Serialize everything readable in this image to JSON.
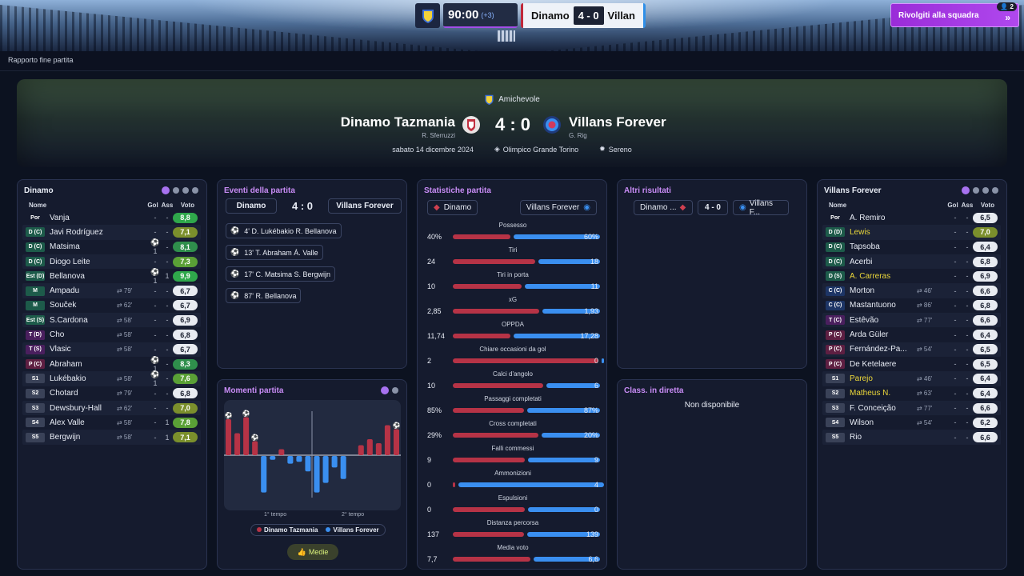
{
  "topbar": {
    "time": "90:00",
    "added_time": "(+3)",
    "home_short": "Dinamo",
    "score": "4 - 0",
    "away_short": "Villan",
    "cta_label": "Rivolgiti alla squadra",
    "cta_badge": "2"
  },
  "breadcrumb": "Rapporto fine partita",
  "match": {
    "competition": "Amichevole",
    "home": "Dinamo Tazmania",
    "home_coach": "R. Sferruzzi",
    "away": "Villans Forever",
    "away_coach": "G. Rig",
    "score": "4 : 0",
    "date": "sabato 14 dicembre 2024",
    "stadium": "Olimpico Grande Torino",
    "weather": "Sereno"
  },
  "home_panel": {
    "title": "Dinamo",
    "headers": {
      "name": "Nome",
      "gol": "Gol",
      "ass": "Ass",
      "voto": "Voto"
    },
    "players": [
      {
        "pos": "Por",
        "name": "Vanja",
        "sub": "",
        "gol": "-",
        "ass": "-",
        "rating": "8,8"
      },
      {
        "pos": "D (C)",
        "name": "Javi Rodríguez",
        "sub": "",
        "gol": "-",
        "ass": "-",
        "rating": "7,1"
      },
      {
        "pos": "D (C)",
        "name": "Matsima",
        "sub": "",
        "gol": "⚽1",
        "ass": "-",
        "rating": "8,1"
      },
      {
        "pos": "D (C)",
        "name": "Diogo Leite",
        "sub": "",
        "gol": "-",
        "ass": "-",
        "rating": "7,3"
      },
      {
        "pos": "Est (D)",
        "name": "Bellanova",
        "sub": "",
        "gol": "⚽1",
        "ass": "1",
        "rating": "9,9"
      },
      {
        "pos": "M",
        "name": "Ampadu",
        "sub": "⇄ 79'",
        "gol": "-",
        "ass": "-",
        "rating": "6,7"
      },
      {
        "pos": "M",
        "name": "Souček",
        "sub": "⇄ 62'",
        "gol": "-",
        "ass": "-",
        "rating": "6,7"
      },
      {
        "pos": "Est (S)",
        "name": "S.Cardona",
        "sub": "⇄ 58'",
        "gol": "-",
        "ass": "-",
        "rating": "6,9"
      },
      {
        "pos": "T (D)",
        "name": "Cho",
        "sub": "⇄ 58'",
        "gol": "-",
        "ass": "-",
        "rating": "6,8"
      },
      {
        "pos": "T (S)",
        "name": "Vlasic",
        "sub": "⇄ 58'",
        "gol": "-",
        "ass": "-",
        "rating": "6,7"
      },
      {
        "pos": "P (C)",
        "name": "Abraham",
        "sub": "",
        "gol": "⚽1",
        "ass": "-",
        "rating": "8,3"
      },
      {
        "pos": "S1",
        "name": "Lukébakio",
        "sub": "⇄ 58'",
        "gol": "⚽1",
        "ass": "-",
        "rating": "7,6"
      },
      {
        "pos": "S2",
        "name": "Chotard",
        "sub": "⇄ 79'",
        "gol": "-",
        "ass": "-",
        "rating": "6,8"
      },
      {
        "pos": "S3",
        "name": "Dewsbury-Hall",
        "sub": "⇄ 62'",
        "gol": "-",
        "ass": "-",
        "rating": "7,0"
      },
      {
        "pos": "S4",
        "name": "Álex Valle",
        "sub": "⇄ 58'",
        "gol": "-",
        "ass": "1",
        "rating": "7,8"
      },
      {
        "pos": "S5",
        "name": "Bergwijn",
        "sub": "⇄ 58'",
        "gol": "-",
        "ass": "1",
        "rating": "7,1"
      }
    ]
  },
  "away_panel": {
    "title": "Villans Forever",
    "headers": {
      "name": "Nome",
      "gol": "Gol",
      "ass": "Ass",
      "voto": "Voto"
    },
    "players": [
      {
        "pos": "Por",
        "name": "Á. Remiro",
        "sub": "",
        "gol": "-",
        "ass": "-",
        "rating": "6,5"
      },
      {
        "pos": "D (D)",
        "name": "Lewis",
        "sub": "",
        "gol": "-",
        "ass": "-",
        "rating": "7,0",
        "hl": true
      },
      {
        "pos": "D (C)",
        "name": "Tapsoba",
        "sub": "",
        "gol": "-",
        "ass": "-",
        "rating": "6,4"
      },
      {
        "pos": "D (C)",
        "name": "Acerbi",
        "sub": "",
        "gol": "-",
        "ass": "-",
        "rating": "6,8"
      },
      {
        "pos": "D (S)",
        "name": "A. Carreras",
        "sub": "",
        "gol": "-",
        "ass": "-",
        "rating": "6,9",
        "hl": true
      },
      {
        "pos": "C (C)",
        "name": "Morton",
        "sub": "⇄ 46'",
        "gol": "-",
        "ass": "-",
        "rating": "6,6"
      },
      {
        "pos": "C (C)",
        "name": "Mastantuono",
        "sub": "⇄ 86'",
        "gol": "-",
        "ass": "-",
        "rating": "6,8"
      },
      {
        "pos": "T (C)",
        "name": "Estêvão",
        "sub": "⇄ 77'",
        "gol": "-",
        "ass": "-",
        "rating": "6,6"
      },
      {
        "pos": "P (C)",
        "name": "Arda Güler",
        "sub": "",
        "gol": "-",
        "ass": "-",
        "rating": "6,4"
      },
      {
        "pos": "P (C)",
        "name": "Fernández-Pa...",
        "sub": "⇄ 54'",
        "gol": "-",
        "ass": "-",
        "rating": "6,5"
      },
      {
        "pos": "P (C)",
        "name": "De Ketelaere",
        "sub": "",
        "gol": "-",
        "ass": "-",
        "rating": "6,5"
      },
      {
        "pos": "S1",
        "name": "Parejo",
        "sub": "⇄ 46'",
        "gol": "-",
        "ass": "-",
        "rating": "6,4",
        "hl": true
      },
      {
        "pos": "S2",
        "name": "Matheus N.",
        "sub": "⇄ 63'",
        "gol": "-",
        "ass": "-",
        "rating": "6,4",
        "hl": true
      },
      {
        "pos": "S3",
        "name": "F. Conceição",
        "sub": "⇄ 77'",
        "gol": "-",
        "ass": "-",
        "rating": "6,6"
      },
      {
        "pos": "S4",
        "name": "Wilson",
        "sub": "⇄ 54'",
        "gol": "-",
        "ass": "-",
        "rating": "6,2"
      },
      {
        "pos": "S5",
        "name": "Rio",
        "sub": "",
        "gol": "-",
        "ass": "-",
        "rating": "6,6"
      }
    ]
  },
  "events": {
    "title": "Eventi della partita",
    "home": "Dinamo",
    "score": "4 : 0",
    "away": "Villans Forever",
    "items": [
      "4'  D. Lukébakio  R. Bellanova",
      "13'  T. Abraham  Á. Valle",
      "17'  C. Matsima  S. Bergwijn",
      "87'  R. Bellanova"
    ]
  },
  "moments": {
    "title": "Momenti partita",
    "first_half": "1° tempo",
    "second_half": "2° tempo",
    "legend_home": "Dinamo Tazmania",
    "legend_away": "Villans Forever",
    "button": "Medie",
    "home_bars": [
      0.9,
      0.55,
      0.95,
      0.35,
      0,
      0,
      0.15,
      0,
      0,
      0,
      0,
      0,
      0,
      0,
      0,
      0.25,
      0.4,
      0.3,
      0.75,
      0.65
    ],
    "away_bars": [
      0,
      0,
      0,
      0,
      0.95,
      0.1,
      0,
      0.2,
      0.15,
      0.4,
      0.95,
      0.7,
      0.3,
      0.6,
      0,
      0,
      0,
      0,
      0,
      0
    ],
    "colors": {
      "home": "#b63346",
      "away": "#3a8ff0"
    }
  },
  "stats": {
    "title": "Statistiche partita",
    "home": "Dinamo",
    "away": "Villans Forever",
    "rows": [
      {
        "label": "Possesso",
        "home": "40%",
        "away": "60%",
        "h": 40,
        "a": 60
      },
      {
        "label": "Tiri",
        "home": "24",
        "away": "18",
        "h": 24,
        "a": 18
      },
      {
        "label": "Tiri in porta",
        "home": "10",
        "away": "11",
        "h": 10,
        "a": 11
      },
      {
        "label": "xG",
        "home": "2,85",
        "away": "1,93",
        "h": 2.85,
        "a": 1.93
      },
      {
        "label": "OPPDA",
        "home": "11,74",
        "away": "17,28",
        "h": 11.74,
        "a": 17.28
      },
      {
        "label": "Chiare occasioni da gol",
        "home": "2",
        "away": "0",
        "h": 2,
        "a": 0
      },
      {
        "label": "Calci d'angolo",
        "home": "10",
        "away": "6",
        "h": 10,
        "a": 6
      },
      {
        "label": "Passaggi completati",
        "home": "85%",
        "away": "87%",
        "h": 85,
        "a": 87
      },
      {
        "label": "Cross completati",
        "home": "29%",
        "away": "20%",
        "h": 29,
        "a": 20
      },
      {
        "label": "Falli commessi",
        "home": "9",
        "away": "9",
        "h": 9,
        "a": 9
      },
      {
        "label": "Ammonizioni",
        "home": "0",
        "away": "4",
        "h": 0,
        "a": 4
      },
      {
        "label": "Espulsioni",
        "home": "0",
        "away": "0",
        "h": 0,
        "a": 0
      },
      {
        "label": "Distanza percorsa",
        "home": "137",
        "away": "139",
        "h": 137,
        "a": 139
      },
      {
        "label": "Media voto",
        "home": "7,7",
        "away": "6,6",
        "h": 7.7,
        "a": 6.6
      }
    ]
  },
  "other_results": {
    "title": "Altri risultati",
    "home": "Dinamo ...",
    "score": "4 - 0",
    "away": "Villans F..."
  },
  "live_table": {
    "title": "Class. in diretta",
    "message": "Non disponibile"
  },
  "colors": {
    "accent": "#a772f0",
    "home": "#b63346",
    "away": "#3a8ff0",
    "highlight_name": "#ecd83a"
  }
}
